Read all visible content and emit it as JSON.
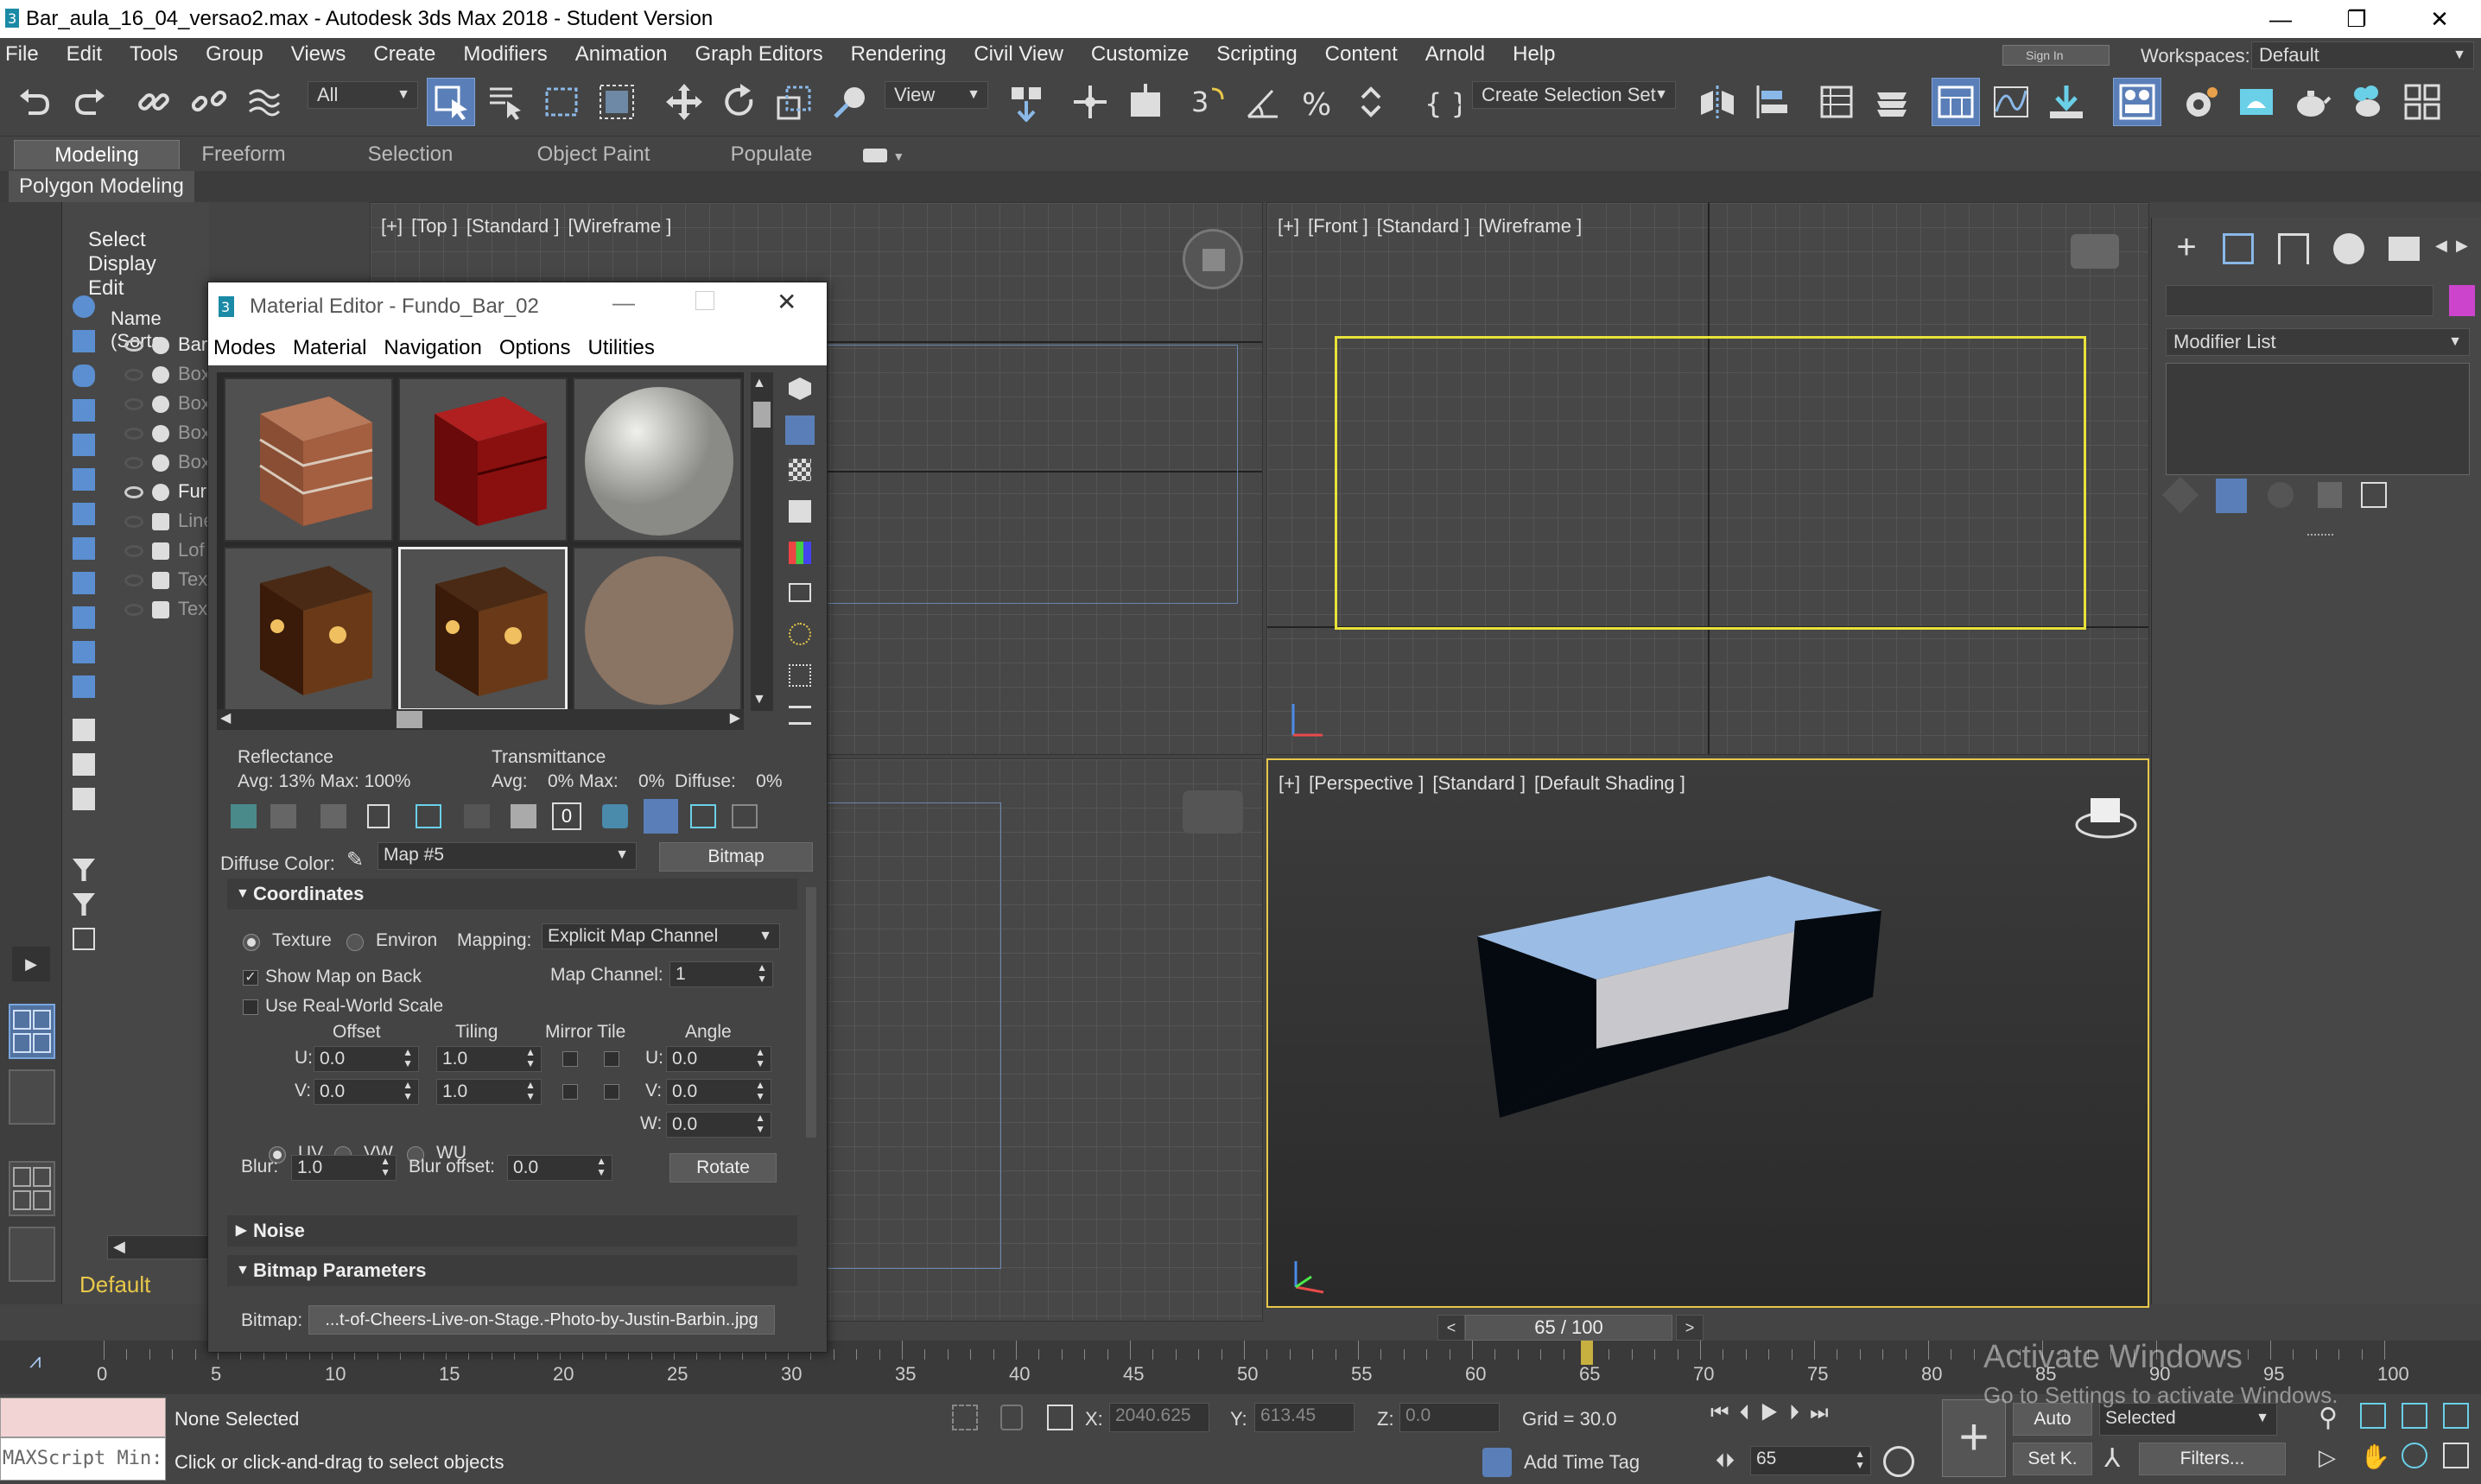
{
  "window": {
    "title": "Bar_aula_16_04_versao2.max - Autodesk 3ds Max 2018 - Student Version",
    "minimize": "—",
    "restore": "❐",
    "close": "✕"
  },
  "menubar": [
    "File",
    "Edit",
    "Tools",
    "Group",
    "Views",
    "Create",
    "Modifiers",
    "Animation",
    "Graph Editors",
    "Rendering",
    "Civil View",
    "Customize",
    "Scripting",
    "Content",
    "Arnold",
    "Help"
  ],
  "signin": "Sign In",
  "workspaces": {
    "label": "Workspaces:",
    "value": "Default"
  },
  "toolbar": {
    "filter": "All",
    "refcoord": "View",
    "selset": "Create Selection Set"
  },
  "ribbon": {
    "tabs": [
      "Modeling",
      "Freeform",
      "Selection",
      "Object Paint",
      "Populate"
    ],
    "active": "Modeling",
    "panel": "Polygon Modeling"
  },
  "scene_explorer": {
    "menu": [
      "Select",
      "Display",
      "Edit"
    ],
    "header": "Name (Sorte",
    "rows": [
      "Bar",
      "Box",
      "Box",
      "Box",
      "Box",
      "Fur",
      "Line",
      "Lof",
      "Tex",
      "Tex"
    ],
    "layer": "Default"
  },
  "viewports": {
    "top": {
      "labels": [
        "[+]",
        "[Top ]",
        "[Standard ]",
        "[Wireframe ]"
      ]
    },
    "front": {
      "labels": [
        "[+]",
        "[Front ]",
        "[Standard ]",
        "[Wireframe ]"
      ]
    },
    "perspective": {
      "labels": [
        "[+]",
        "[Perspective ]",
        "[Standard ]",
        "[Default Shading ]"
      ]
    }
  },
  "command_panel": {
    "modifier_list": "Modifier List"
  },
  "material_editor": {
    "title": "Material Editor - Fundo_Bar_02",
    "menu": [
      "Modes",
      "Material",
      "Navigation",
      "Options",
      "Utilities"
    ],
    "reflectance": {
      "label": "Reflectance",
      "values": "Avg:  13% Max: 100%"
    },
    "transmittance": {
      "label": "Transmittance",
      "values": "Avg:    0% Max:    0%  Diffuse:    0%"
    },
    "diffuse": {
      "label": "Diffuse Color:",
      "map": "Map #5",
      "type": "Bitmap"
    },
    "coordinates": {
      "title": "Coordinates",
      "texture": "Texture",
      "environ": "Environ",
      "mapping_label": "Mapping:",
      "mapping": "Explicit Map Channel",
      "show_map_back": "Show Map on Back",
      "map_channel_label": "Map Channel:",
      "map_channel": "1",
      "real_world": "Use Real-World Scale",
      "col_offset": "Offset",
      "col_tiling": "Tiling",
      "col_mirror": "Mirror Tile",
      "col_angle": "Angle",
      "u_label": "U:",
      "v_label": "V:",
      "w_label": "W:",
      "u_offset": "0.0",
      "v_offset": "0.0",
      "u_tiling": "1.0",
      "v_tiling": "1.0",
      "u_angle": "0.0",
      "v_angle": "0.0",
      "w_angle": "0.0",
      "uv": "UV",
      "vw": "VW",
      "wu": "WU",
      "blur_label": "Blur:",
      "blur": "1.0",
      "blur_offset_label": "Blur offset:",
      "blur_offset": "0.0",
      "rotate": "Rotate"
    },
    "noise": "Noise",
    "bitmap_params": {
      "title": "Bitmap Parameters",
      "label": "Bitmap:",
      "file": "...t-of-Cheers-Live-on-Stage.-Photo-by-Justin-Barbin..jpg"
    }
  },
  "timeline": {
    "frame": "65 / 100",
    "ticks": [
      "0",
      "5",
      "10",
      "15",
      "20",
      "25",
      "30",
      "35",
      "40",
      "45",
      "50",
      "55",
      "60",
      "65",
      "70",
      "75",
      "80",
      "85",
      "90",
      "95",
      "100"
    ],
    "current": 65,
    "total": 100
  },
  "status": {
    "maxscript": "MAXScript Min:",
    "selection": "None Selected",
    "prompt": "Click or click-and-drag to select objects",
    "x_label": "X:",
    "x": "2040.625",
    "y_label": "Y:",
    "y": "613.45",
    "z_label": "Z:",
    "z": "0.0",
    "grid": "Grid = 30.0",
    "add_time_tag": "Add Time Tag",
    "auto": "Auto",
    "selected": "Selected",
    "setk": "Set K.",
    "filters": "Filters...",
    "frame_field": "65"
  },
  "watermark": {
    "line1": "Activate Windows",
    "line2": "Go to Settings to activate Windows."
  },
  "colors": {
    "accent": "#5a7fb8",
    "wire_yellow": "#e8e23a",
    "box_top": "#9bbce4",
    "layer_yellow": "#e8c84a"
  }
}
